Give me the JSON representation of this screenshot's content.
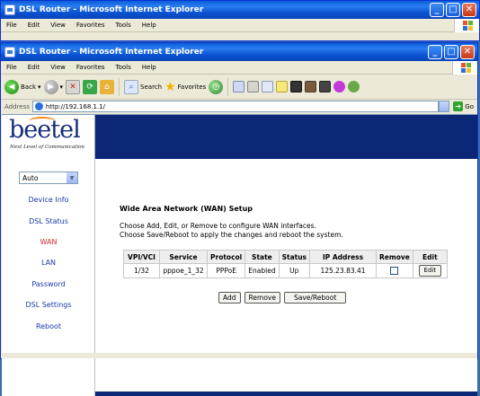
{
  "back_window": {
    "title": "DSL Router - Microsoft Internet Explorer",
    "menu": [
      "File",
      "Edit",
      "View",
      "Favorites",
      "Tools",
      "Help"
    ]
  },
  "window": {
    "title": "DSL Router - Microsoft Internet Explorer",
    "controls": {
      "minimize": "_",
      "maximize": "□",
      "close": "✕"
    }
  },
  "menu": [
    "File",
    "Edit",
    "View",
    "Favorites",
    "Tools",
    "Help"
  ],
  "toolbar": {
    "back_label": "Back",
    "search_label": "Search",
    "favorites_label": "Favorites"
  },
  "address": {
    "label": "Address",
    "url": "http://192.168.1.1/",
    "go_label": "Go"
  },
  "brand": {
    "logo": "beetel",
    "tagline": "Next Level of Communication"
  },
  "sidebar": {
    "language": "Auto",
    "items": [
      {
        "label": "Device Info",
        "active": false
      },
      {
        "label": "DSL Status",
        "active": false
      },
      {
        "label": "WAN",
        "active": true
      },
      {
        "label": "LAN",
        "active": false
      },
      {
        "label": "Password",
        "active": false
      },
      {
        "label": "DSL Settings",
        "active": false
      },
      {
        "label": "Reboot",
        "active": false
      }
    ]
  },
  "page": {
    "title": "Wide Area Network (WAN) Setup",
    "desc_line1": "Choose Add, Edit, or Remove to configure WAN interfaces.",
    "desc_line2": "Choose Save/Reboot to apply the changes and reboot the system."
  },
  "table": {
    "headers": [
      "VPI/VCI",
      "Service",
      "Protocol",
      "State",
      "Status",
      "IP Address",
      "Remove",
      "Edit"
    ],
    "rows": [
      {
        "vpivci": "1/32",
        "service": "pppoe_1_32",
        "protocol": "PPPoE",
        "state": "Enabled",
        "status": "Up",
        "ip": "125.23.83.41",
        "remove_checked": false,
        "edit_label": "Edit"
      }
    ]
  },
  "buttons": {
    "add": "Add",
    "remove": "Remove",
    "save_reboot": "Save/Reboot"
  },
  "colors": {
    "banner": "#0c2776",
    "link": "#1a3aa8",
    "active_link": "#d42a2a",
    "logo_accent": "#f28c1a"
  }
}
